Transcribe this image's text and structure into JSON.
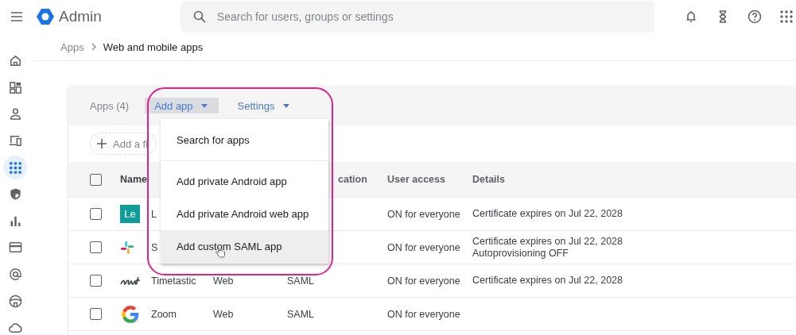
{
  "topbar": {
    "brand": "Admin",
    "search_placeholder": "Search for users, groups or settings"
  },
  "rail": [
    {
      "kind": "home",
      "selected": false
    },
    {
      "kind": "dashboard",
      "selected": false
    },
    {
      "kind": "user",
      "selected": false
    },
    {
      "kind": "devices",
      "selected": false
    },
    {
      "kind": "apps",
      "selected": true
    },
    {
      "kind": "security",
      "selected": false
    },
    {
      "kind": "reports",
      "selected": false
    },
    {
      "kind": "billing",
      "selected": false
    },
    {
      "kind": "account",
      "selected": false
    },
    {
      "kind": "rules",
      "selected": false
    },
    {
      "kind": "storage",
      "selected": false
    }
  ],
  "breadcrumb": [
    "Apps",
    "Web and mobile apps"
  ],
  "card": {
    "title": "Apps (4)",
    "add_button": "Add app",
    "settings": "Settings",
    "filter": "Add a fi"
  },
  "table": {
    "select_all_checked": false,
    "columns": [
      "Name",
      "cation",
      "User access",
      "Details"
    ],
    "rows": [
      {
        "checked": false,
        "kind": "tile",
        "logo_text": "Le",
        "name": "L",
        "access": "ON for everyone",
        "details": [
          "Certificate expires on Jul 22, 2028"
        ]
      },
      {
        "checked": false,
        "kind": "slack",
        "name": "S",
        "access": "ON for everyone",
        "details": [
          "Certificate expires on Jul 22, 2028",
          "Autoprovisioning OFF"
        ]
      },
      {
        "checked": false,
        "kind": "wordmark",
        "name": "Timetastic",
        "type": "Web",
        "method": "SAML",
        "access": "ON for everyone",
        "details": [
          "Certificate expires on Jul 22, 2028"
        ]
      },
      {
        "checked": false,
        "kind": "google",
        "name": "Zoom",
        "type": "Web",
        "method": "SAML",
        "access": "ON for everyone"
      }
    ]
  },
  "menu": {
    "items": [
      {
        "label": "Search for apps",
        "hovered": false
      },
      {
        "label": "Add private Android app",
        "hovered": false
      },
      {
        "label": "Add private Android web app",
        "hovered": false
      },
      {
        "label": "Add custom SAML app",
        "hovered": true
      }
    ]
  }
}
